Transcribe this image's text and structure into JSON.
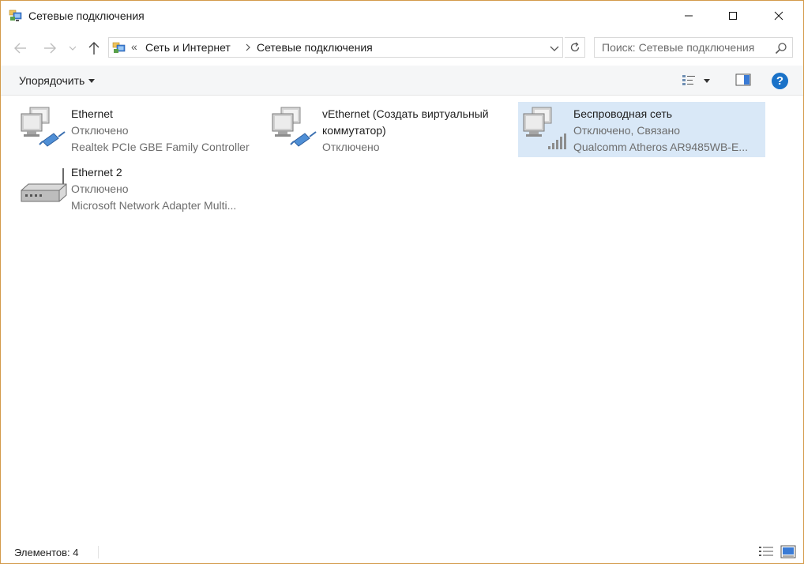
{
  "window": {
    "title": "Сетевые подключения"
  },
  "address": {
    "overflow": "«",
    "crumbs": [
      "Сеть и Интернет",
      "Сетевые подключения"
    ]
  },
  "search": {
    "placeholder": "Поиск: Сетевые подключения"
  },
  "commandbar": {
    "organize_label": "Упорядочить",
    "help_label": "?"
  },
  "items": [
    {
      "name": "Ethernet",
      "status": "Отключено",
      "device": "Realtek PCIe GBE Family Controller",
      "icon": "wired-network-icon",
      "selected": false
    },
    {
      "name": "vEthernet (Создать виртуальный коммутатор)",
      "status": "Отключено",
      "device": "",
      "icon": "wired-network-icon",
      "selected": false
    },
    {
      "name": "Беспроводная сеть",
      "status": "Отключено, Связано",
      "device": "Qualcomm Atheros AR9485WB-E...",
      "icon": "wireless-network-icon",
      "selected": true
    },
    {
      "name": "Ethernet 2",
      "status": "Отключено",
      "device": "Microsoft Network Adapter Multi...",
      "icon": "network-adapter-icon",
      "selected": false
    }
  ],
  "status": {
    "count_label": "Элементов: 4"
  },
  "colors": {
    "selection": "#d9e8f7",
    "help": "#1a72c8",
    "window_border": "#d39a4a"
  }
}
